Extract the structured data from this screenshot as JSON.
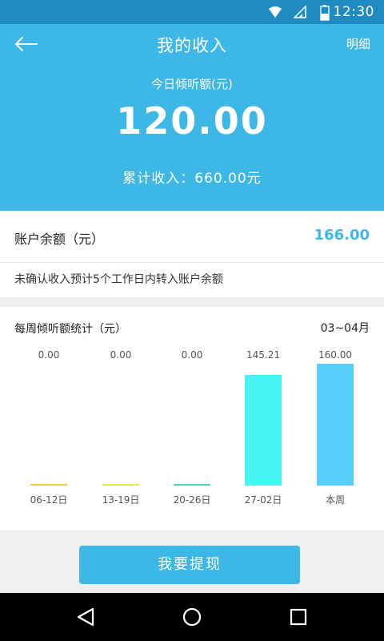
{
  "status_bar": {
    "time": "12:30",
    "icons": [
      "wifi-icon",
      "signal-icon",
      "battery-icon"
    ]
  },
  "app_bar": {
    "back_icon": "arrow-left-icon",
    "title": "我的收入",
    "detail_label": "明细"
  },
  "summary": {
    "today_label": "今日倾听额(元)",
    "today_amount": "120.00",
    "total_text": "累计收入：660.00元"
  },
  "account": {
    "balance_label": "账户余额（元）",
    "balance_value": "166.00",
    "note": "未确认收入预计5个工作日内转入账户余额"
  },
  "weekly": {
    "title": "每周倾听额统计（元）",
    "range": "03~04月"
  },
  "chart_data": {
    "type": "bar",
    "categories": [
      "06-12日",
      "13-19日",
      "20-26日",
      "27-02日",
      "本周"
    ],
    "values": [
      0.0,
      0.0,
      0.0,
      145.21,
      160.0
    ],
    "value_labels": [
      "0.00",
      "0.00",
      "0.00",
      "145.21",
      "160.00"
    ],
    "colors": [
      "#f4c64a",
      "#e3e84f",
      "#49d3b2",
      "#48f4f2",
      "#56d0fb"
    ],
    "ylim": [
      0,
      160
    ],
    "grid": false
  },
  "withdraw_button": "我要提现",
  "colors": {
    "primary": "#3cb7e6",
    "status_bar": "#1f8bc0",
    "nav_bar": "#000000"
  },
  "nav": {
    "back": "nav-back-icon",
    "home": "nav-home-icon",
    "recents": "nav-recents-icon"
  }
}
